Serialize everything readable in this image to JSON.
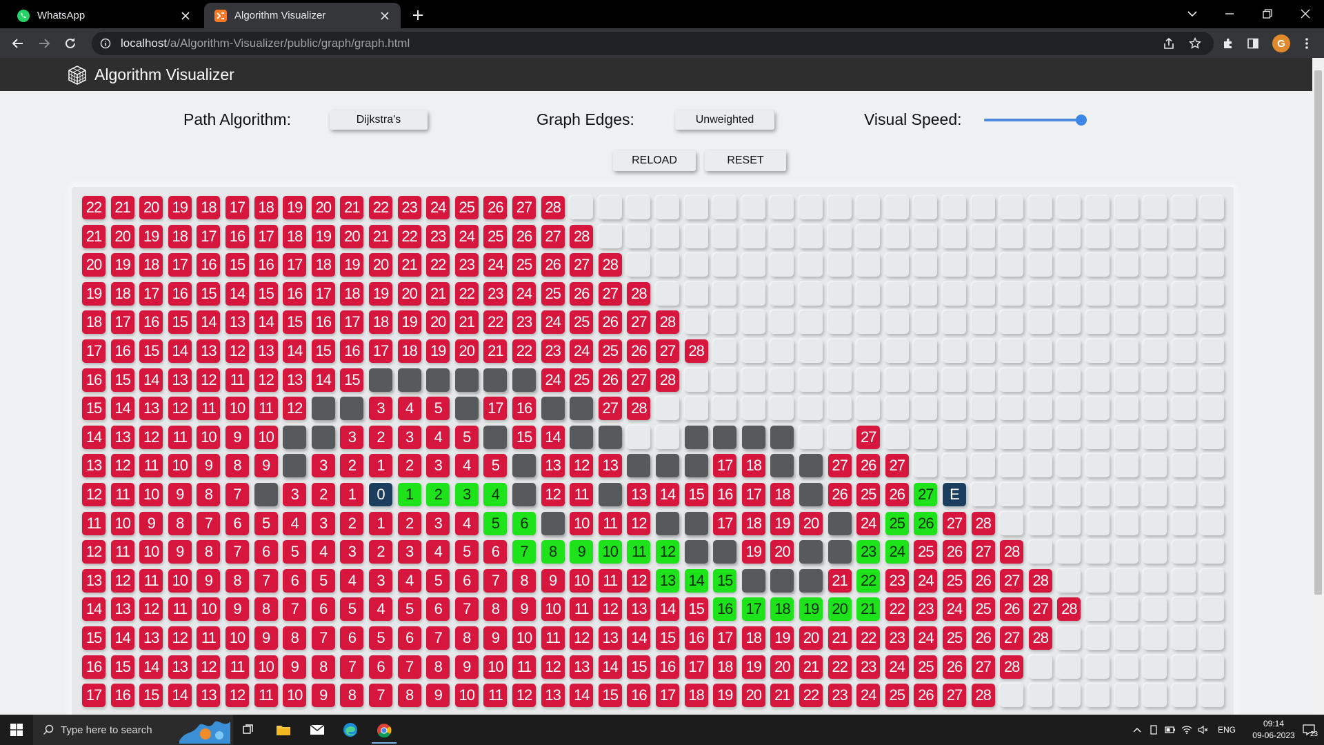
{
  "browser": {
    "tabs": [
      {
        "title": "WhatsApp",
        "active": false
      },
      {
        "title": "Algorithm Visualizer",
        "active": true
      }
    ],
    "url_host": "localhost",
    "url_path": "/a/Algorithm-Visualizer/public/graph/graph.html",
    "profile_initial": "G"
  },
  "app": {
    "title": "Algorithm Visualizer",
    "controls": {
      "path_label": "Path Algorithm:",
      "path_value": "Dijkstra's",
      "edges_label": "Graph Edges:",
      "edges_value": "Unweighted",
      "speed_label": "Visual Speed:",
      "speed_level": 0.95,
      "reload_label": "RELOAD",
      "reset_label": "RESET"
    }
  },
  "grid": {
    "cols": 40,
    "rows": [
      {
        "start": 0,
        "cells": [
          "22",
          "21",
          "20",
          "19",
          "18",
          "17",
          "18",
          "19",
          "20",
          "21",
          "22",
          "23",
          "24",
          "25",
          "26",
          "27",
          "28"
        ]
      },
      {
        "start": 0,
        "cells": [
          "21",
          "20",
          "19",
          "18",
          "17",
          "16",
          "17",
          "18",
          "19",
          "20",
          "21",
          "22",
          "23",
          "24",
          "25",
          "26",
          "27",
          "28"
        ]
      },
      {
        "start": 0,
        "cells": [
          "20",
          "19",
          "18",
          "17",
          "16",
          "15",
          "16",
          "17",
          "18",
          "19",
          "20",
          "21",
          "22",
          "23",
          "24",
          "25",
          "26",
          "27",
          "28"
        ]
      },
      {
        "start": 0,
        "cells": [
          "19",
          "18",
          "17",
          "16",
          "15",
          "14",
          "15",
          "16",
          "17",
          "18",
          "19",
          "20",
          "21",
          "22",
          "23",
          "24",
          "25",
          "26",
          "27",
          "28"
        ]
      },
      {
        "start": 0,
        "cells": [
          "18",
          "17",
          "16",
          "15",
          "14",
          "13",
          "14",
          "15",
          "16",
          "17",
          "18",
          "19",
          "20",
          "21",
          "22",
          "23",
          "24",
          "25",
          "26",
          "27",
          "28"
        ]
      },
      {
        "start": 0,
        "cells": [
          "17",
          "16",
          "15",
          "14",
          "13",
          "12",
          "13",
          "14",
          "15",
          "16",
          "17",
          "18",
          "19",
          "20",
          "21",
          "22",
          "23",
          "24",
          "25",
          "26",
          "27",
          "28"
        ]
      },
      {
        "start": 0,
        "cells": [
          "16",
          "15",
          "14",
          "13",
          "12",
          "11",
          "12",
          "13",
          "14",
          "15",
          "#",
          "#",
          "#",
          "#",
          "#",
          "#",
          "24",
          "25",
          "26",
          "27",
          "28"
        ]
      },
      {
        "start": 0,
        "cells": [
          "15",
          "14",
          "13",
          "12",
          "11",
          "10",
          "11",
          "12",
          "#",
          "#",
          "3",
          "4",
          "5",
          "#",
          "17",
          "16",
          "#",
          "#",
          "27",
          "28"
        ]
      },
      {
        "start": 0,
        "cells": [
          "14",
          "13",
          "12",
          "11",
          "10",
          "9",
          "10",
          "#",
          "#",
          "3",
          "2",
          "3",
          "4",
          "5",
          "#",
          "15",
          "14",
          "#",
          "#",
          ".",
          ".",
          "#",
          "#",
          "#",
          "#",
          ".",
          ".",
          "27"
        ]
      },
      {
        "start": 0,
        "cells": [
          "13",
          "12",
          "11",
          "10",
          "9",
          "8",
          "9",
          "#",
          "3",
          "2",
          "1",
          "2",
          "3",
          "4",
          "5",
          "#",
          "13",
          "12",
          "13",
          "#",
          "#",
          "#",
          "17",
          "18",
          "#",
          "#",
          "27",
          "26",
          "27"
        ]
      },
      {
        "start": 0,
        "cells": [
          "12",
          "11",
          "10",
          "9",
          "8",
          "7",
          "#",
          "3",
          "2",
          "1",
          "S:0",
          "P:1",
          "P:2",
          "P:3",
          "P:4",
          "#",
          "12",
          "11",
          "#",
          "13",
          "14",
          "15",
          "16",
          "17",
          "18",
          "#",
          "26",
          "25",
          "26",
          "P:27",
          "E:E"
        ]
      },
      {
        "start": 0,
        "cells": [
          "11",
          "10",
          "9",
          "8",
          "7",
          "6",
          "5",
          "4",
          "3",
          "2",
          "1",
          "2",
          "3",
          "4",
          "P:5",
          "P:6",
          "#",
          "10",
          "11",
          "12",
          "#",
          "#",
          "17",
          "18",
          "19",
          "20",
          "#",
          "24",
          "P:25",
          "P:26",
          "27",
          "28"
        ]
      },
      {
        "start": 0,
        "cells": [
          "12",
          "11",
          "10",
          "9",
          "8",
          "7",
          "6",
          "5",
          "4",
          "3",
          "2",
          "3",
          "4",
          "5",
          "6",
          "P:7",
          "P:8",
          "P:9",
          "P:10",
          "P:11",
          "P:12",
          "#",
          "#",
          "19",
          "20",
          "#",
          "#",
          "P:23",
          "P:24",
          "25",
          "26",
          "27",
          "28"
        ]
      },
      {
        "start": 0,
        "cells": [
          "13",
          "12",
          "11",
          "10",
          "9",
          "8",
          "7",
          "6",
          "5",
          "4",
          "3",
          "4",
          "5",
          "6",
          "7",
          "8",
          "9",
          "10",
          "11",
          "12",
          "P:13",
          "P:14",
          "P:15",
          "#",
          "#",
          "#",
          "21",
          "P:22",
          "23",
          "24",
          "25",
          "26",
          "27",
          "28"
        ]
      },
      {
        "start": 0,
        "cells": [
          "14",
          "13",
          "12",
          "11",
          "10",
          "9",
          "8",
          "7",
          "6",
          "5",
          "4",
          "5",
          "6",
          "7",
          "8",
          "9",
          "10",
          "11",
          "12",
          "13",
          "14",
          "15",
          "P:16",
          "P:17",
          "P:18",
          "P:19",
          "P:20",
          "P:21",
          "22",
          "23",
          "24",
          "25",
          "26",
          "27",
          "28"
        ]
      },
      {
        "start": 0,
        "cells": [
          "15",
          "14",
          "13",
          "12",
          "11",
          "10",
          "9",
          "8",
          "7",
          "6",
          "5",
          "6",
          "7",
          "8",
          "9",
          "10",
          "11",
          "12",
          "13",
          "14",
          "15",
          "16",
          "17",
          "18",
          "19",
          "20",
          "21",
          "22",
          "23",
          "24",
          "25",
          "26",
          "27",
          "28"
        ]
      },
      {
        "start": 0,
        "cells": [
          "16",
          "15",
          "14",
          "13",
          "12",
          "11",
          "10",
          "9",
          "8",
          "7",
          "6",
          "7",
          "8",
          "9",
          "10",
          "11",
          "12",
          "13",
          "14",
          "15",
          "16",
          "17",
          "18",
          "19",
          "20",
          "21",
          "22",
          "23",
          "24",
          "25",
          "26",
          "27",
          "28"
        ]
      },
      {
        "start": 0,
        "cells": [
          "17",
          "16",
          "15",
          "14",
          "13",
          "12",
          "11",
          "10",
          "9",
          "8",
          "7",
          "8",
          "9",
          "10",
          "11",
          "12",
          "13",
          "14",
          "15",
          "16",
          "17",
          "18",
          "19",
          "20",
          "21",
          "22",
          "23",
          "24",
          "25",
          "26",
          "27",
          "28"
        ]
      }
    ]
  },
  "taskbar": {
    "search_placeholder": "Type here to search",
    "lang": "ENG",
    "time": "09:14",
    "date": "09-06-2023",
    "notifications": "23"
  }
}
